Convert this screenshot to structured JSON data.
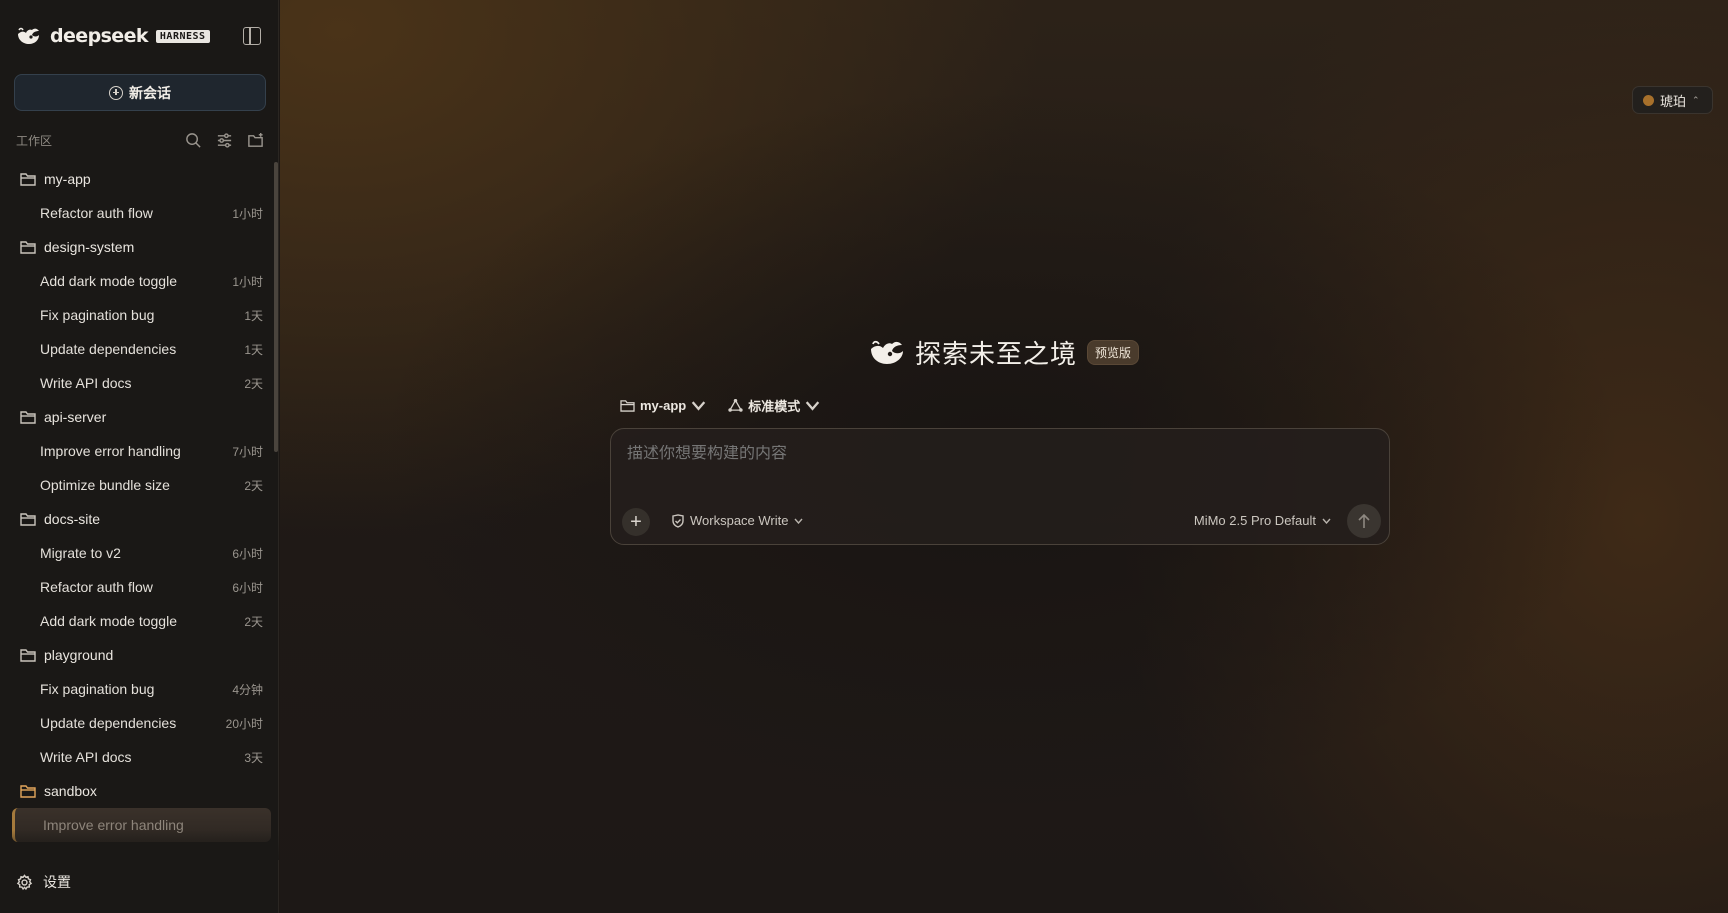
{
  "brand": {
    "name": "deepseek",
    "tag": "HARNESS"
  },
  "sidebar": {
    "new_chat_label": "新会话",
    "workspace_label": "工作区",
    "settings_label": "设置",
    "folders": [
      {
        "name": "my-app",
        "sessions": [
          {
            "title": "Refactor auth flow",
            "time": "1小时"
          }
        ]
      },
      {
        "name": "design-system",
        "sessions": [
          {
            "title": "Add dark mode toggle",
            "time": "1小时"
          },
          {
            "title": "Fix pagination bug",
            "time": "1天"
          },
          {
            "title": "Update dependencies",
            "time": "1天"
          },
          {
            "title": "Write API docs",
            "time": "2天"
          }
        ]
      },
      {
        "name": "api-server",
        "sessions": [
          {
            "title": "Improve error handling",
            "time": "7小时"
          },
          {
            "title": "Optimize bundle size",
            "time": "2天"
          }
        ]
      },
      {
        "name": "docs-site",
        "sessions": [
          {
            "title": "Migrate to v2",
            "time": "6小时"
          },
          {
            "title": "Refactor auth flow",
            "time": "6小时"
          },
          {
            "title": "Add dark mode toggle",
            "time": "2天"
          }
        ]
      },
      {
        "name": "playground",
        "sessions": [
          {
            "title": "Fix pagination bug",
            "time": "4分钟"
          },
          {
            "title": "Update dependencies",
            "time": "20小时"
          },
          {
            "title": "Write API docs",
            "time": "3天"
          }
        ]
      },
      {
        "name": "sandbox",
        "sessions": [
          {
            "title": "Improve error handling",
            "time": "",
            "active": true
          }
        ]
      }
    ]
  },
  "theme": {
    "label": "琥珀",
    "color": "#a7702b"
  },
  "hero": {
    "title": "探索未至之境",
    "badge": "预览版"
  },
  "composer": {
    "project": "my-app",
    "mode": "标准模式",
    "placeholder": "描述你想要构建的内容",
    "permission": "Workspace Write",
    "model": "MiMo 2.5 Pro Default"
  },
  "colors": {
    "accent": "#a7702b",
    "background": "#1c1714",
    "sidebar": "#1a1816"
  }
}
